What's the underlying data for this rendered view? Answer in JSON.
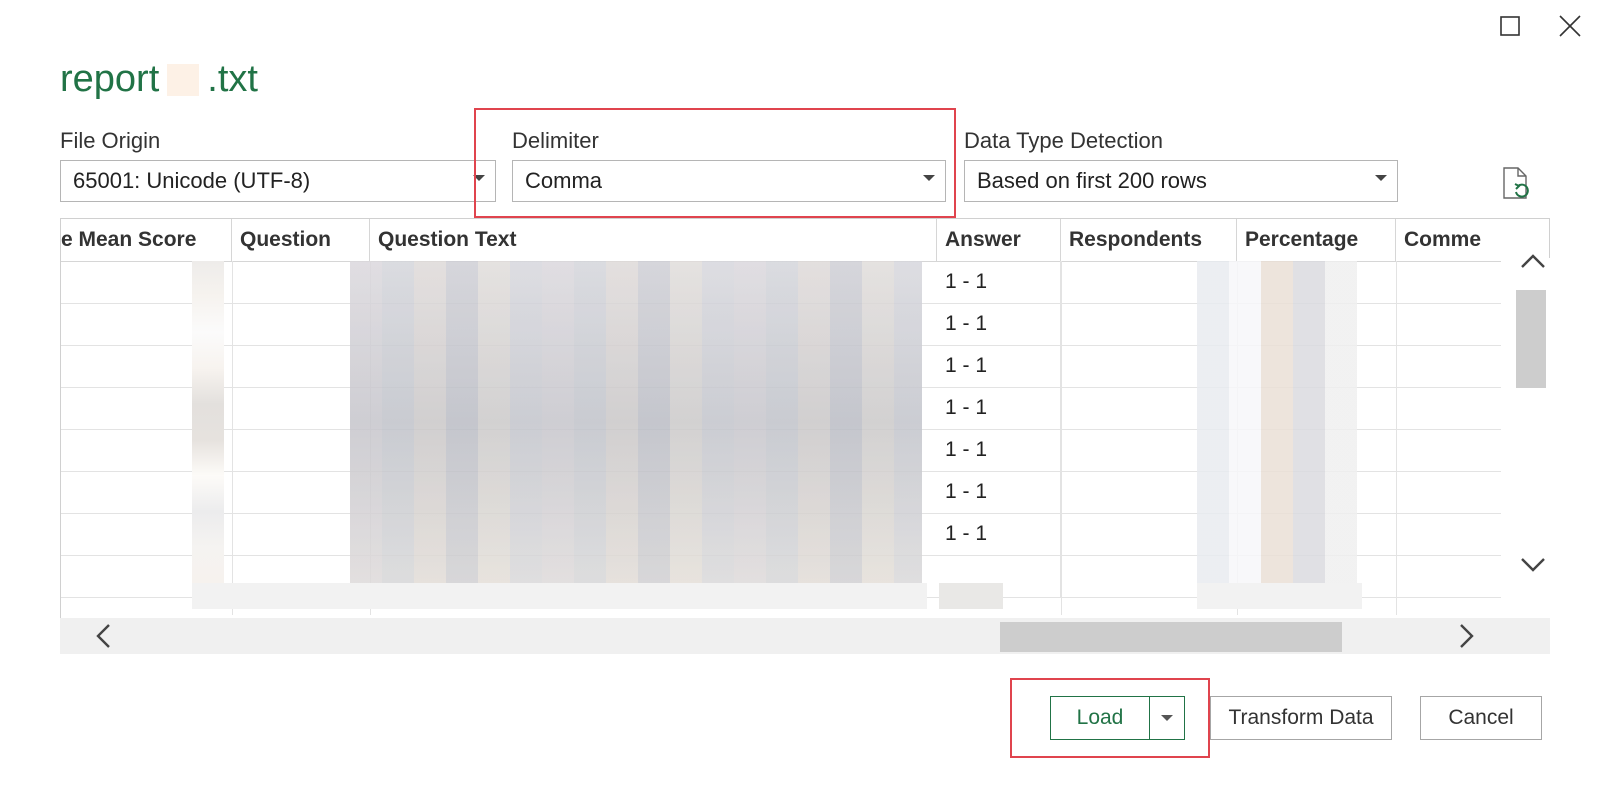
{
  "window": {
    "maximize_icon": "maximize-icon",
    "close_icon": "close-icon"
  },
  "title": {
    "prefix": "report",
    "suffix": ".txt"
  },
  "options": {
    "file_origin": {
      "label": "File Origin",
      "value": "65001: Unicode (UTF-8)"
    },
    "delimiter": {
      "label": "Delimiter",
      "value": "Comma"
    },
    "data_type_detection": {
      "label": "Data Type Detection",
      "value": "Based on first 200 rows"
    },
    "refresh_icon": "refresh-file-icon"
  },
  "grid": {
    "columns": [
      "e Mean Score",
      "Question",
      "Question Text",
      "Answer",
      "Respondents",
      "Percentage",
      "Comme"
    ],
    "answers": [
      "1 - 1",
      "1 - 1",
      "1 - 1",
      "1 - 1",
      "1 - 1",
      "1 - 1",
      "1 - 1",
      ""
    ]
  },
  "buttons": {
    "load": "Load",
    "transform": "Transform Data",
    "cancel": "Cancel"
  },
  "colors": {
    "accent": "#217346",
    "highlight": "#e0444e"
  }
}
